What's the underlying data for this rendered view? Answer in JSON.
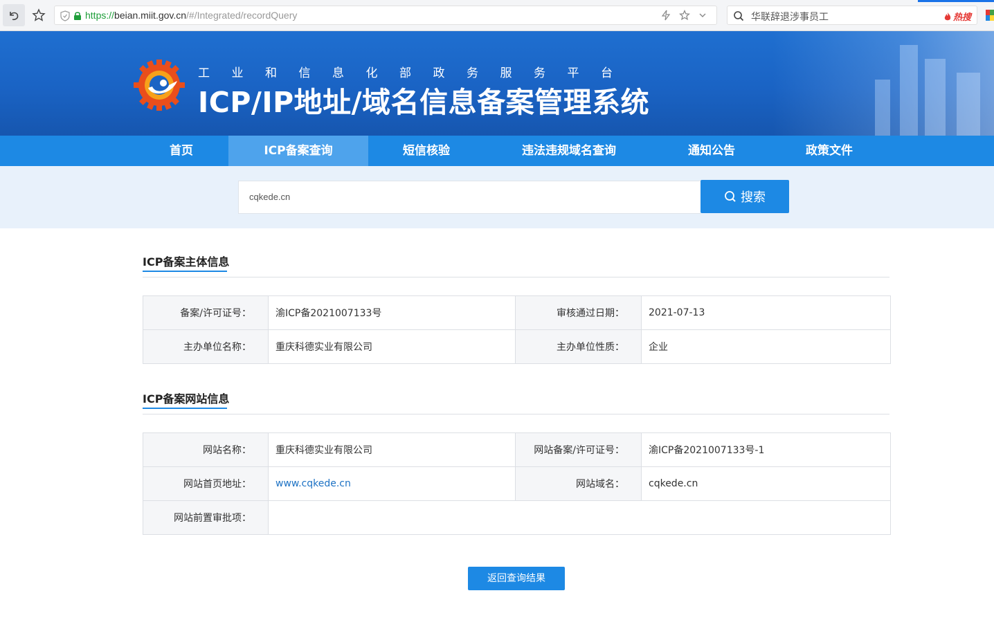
{
  "browser": {
    "url_protocol": "https://",
    "url_host": "beian.miit.gov.cn",
    "url_path": "/#/Integrated/recordQuery",
    "search_query": "华联辞退涉事员工",
    "hot_label": "热搜"
  },
  "header": {
    "subtitle": "工业和信息化部政务服务平台",
    "title": "ICP/IP地址/域名信息备案管理系统"
  },
  "nav": {
    "items": [
      {
        "label": "首页"
      },
      {
        "label": "ICP备案查询"
      },
      {
        "label": "短信核验"
      },
      {
        "label": "违法违规域名查询"
      },
      {
        "label": "通知公告"
      },
      {
        "label": "政策文件"
      }
    ],
    "active_index": 1
  },
  "search": {
    "value": "cqkede.cn",
    "button_label": "搜索"
  },
  "subject_section": {
    "title": "ICP备案主体信息",
    "rows": [
      [
        {
          "label": "备案/许可证号：",
          "value": "渝ICP备2021007133号"
        },
        {
          "label": "审核通过日期：",
          "value": "2021-07-13"
        }
      ],
      [
        {
          "label": "主办单位名称：",
          "value": "重庆科德实业有限公司"
        },
        {
          "label": "主办单位性质：",
          "value": "企业"
        }
      ]
    ]
  },
  "website_section": {
    "title": "ICP备案网站信息",
    "site_name_label": "网站名称：",
    "site_name": "重庆科德实业有限公司",
    "site_license_label": "网站备案/许可证号：",
    "site_license": "渝ICP备2021007133号-1",
    "homepage_label": "网站首页地址：",
    "homepage": "www.cqkede.cn",
    "domain_label": "网站域名：",
    "domain": "cqkede.cn",
    "preapproval_label": "网站前置审批项：",
    "preapproval": ""
  },
  "back_button": "返回查询结果",
  "colors": {
    "primary": "#1d89e4",
    "banner": "#1a63c4",
    "search_bg": "#e8f1fb",
    "link": "#1d72c4"
  }
}
